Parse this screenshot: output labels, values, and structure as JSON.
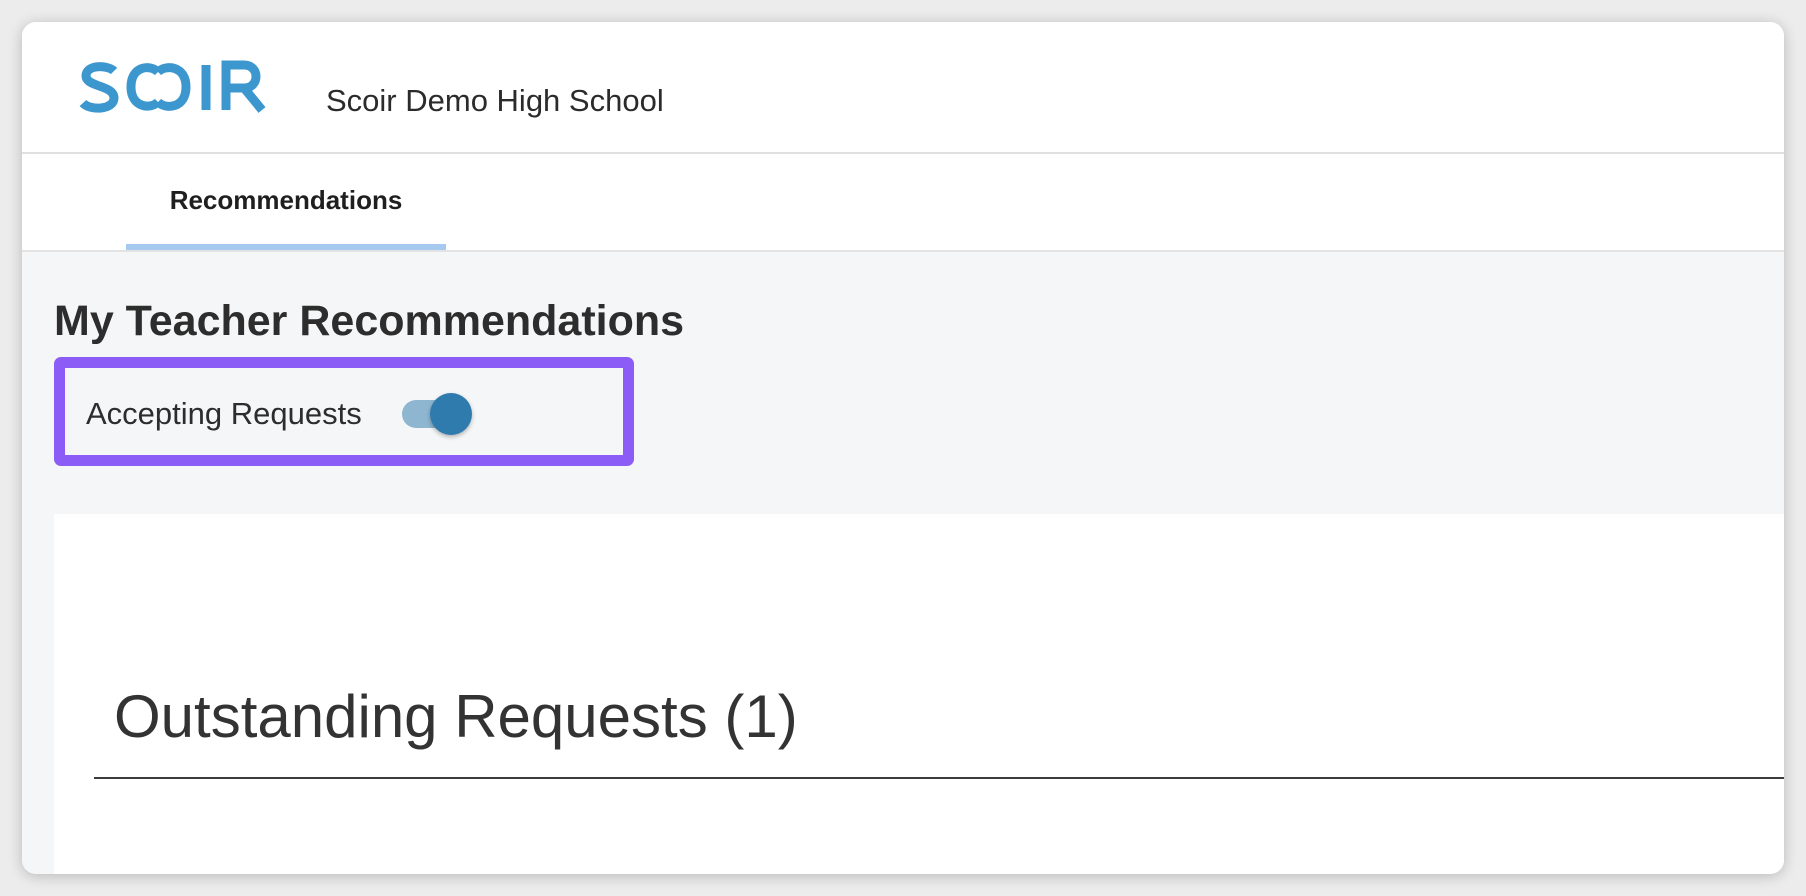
{
  "header": {
    "logo_text": "SCOIR",
    "school_name": "Scoir Demo High School"
  },
  "tabs": [
    {
      "label": "Recommendations",
      "active": true
    }
  ],
  "page": {
    "title": "My Teacher Recommendations",
    "toggle": {
      "label": "Accepting Requests",
      "on": true
    }
  },
  "section": {
    "title": "Outstanding Requests (1)"
  },
  "colors": {
    "brand": "#3d97cf",
    "highlight": "#8b5cf6",
    "tab_underline": "#a6c9ef",
    "toggle_thumb": "#2f7bad",
    "toggle_track": "#8fb6d1"
  }
}
